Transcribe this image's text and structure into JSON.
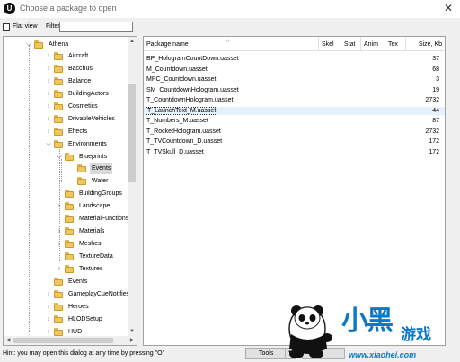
{
  "window": {
    "title": "Choose a package to open",
    "app_icon": "U",
    "close": "✕"
  },
  "filterbar": {
    "flat_view_label": "Flat view",
    "filter_label": "Filter:",
    "filter_value": ""
  },
  "tree": {
    "items": [
      {
        "label": "Athena",
        "expander": "⌵"
      },
      {
        "label": "Aircraft",
        "expander": "›"
      },
      {
        "label": "Bacchus",
        "expander": "›"
      },
      {
        "label": "Balance",
        "expander": "›"
      },
      {
        "label": "BuildingActors",
        "expander": "›"
      },
      {
        "label": "Cosmetics",
        "expander": "›"
      },
      {
        "label": "DrivableVehicles",
        "expander": "›"
      },
      {
        "label": "Effects",
        "expander": "›"
      },
      {
        "label": "Environments",
        "expander": "⌵"
      },
      {
        "label": "Blueprints",
        "expander": "⌵"
      },
      {
        "label": "Events",
        "expander": ""
      },
      {
        "label": "Water",
        "expander": ""
      },
      {
        "label": "BuildingGroups",
        "expander": ""
      },
      {
        "label": "Landscape",
        "expander": "›"
      },
      {
        "label": "MaterialFunctions",
        "expander": ""
      },
      {
        "label": "Materials",
        "expander": "›"
      },
      {
        "label": "Meshes",
        "expander": "›"
      },
      {
        "label": "TextureData",
        "expander": ""
      },
      {
        "label": "Textures",
        "expander": "›"
      },
      {
        "label": "Events",
        "expander": ""
      },
      {
        "label": "GameplayCueNotifies",
        "expander": "›"
      },
      {
        "label": "Heroes",
        "expander": "›"
      },
      {
        "label": "HLODSetup",
        "expander": "›"
      },
      {
        "label": "HUD",
        "expander": "›"
      }
    ]
  },
  "files": {
    "columns": [
      "Package name",
      "Skel",
      "Stat",
      "Anim",
      "Tex",
      "Size, Kb"
    ],
    "rows": [
      {
        "name": "BP_HologramCountDown.uasset",
        "size": "37"
      },
      {
        "name": "M_Countdown.uasset",
        "size": "68"
      },
      {
        "name": "MPC_Countdown.uasset",
        "size": "3"
      },
      {
        "name": "SM_CountdownHologram.uasset",
        "size": "19"
      },
      {
        "name": "T_CountdownHologram.uasset",
        "size": "2732"
      },
      {
        "name": "T_LaunchText_M.uasset",
        "size": "44"
      },
      {
        "name": "T_Numbers_M.uasset",
        "size": "87"
      },
      {
        "name": "T_RocketHologram.uasset",
        "size": "2732"
      },
      {
        "name": "T_TVCountdown_D.uasset",
        "size": "172"
      },
      {
        "name": "T_TVSkull_D.uasset",
        "size": "172"
      }
    ]
  },
  "status": {
    "hint": "Hint: you may open this dialog at any time by pressing \"O\"",
    "tools_label": "Tools",
    "tools_dropdown": "▼"
  },
  "watermark": {
    "logo_text": "小黑",
    "logo_sub": "游戏",
    "url": "www.xiaohei.com"
  },
  "icons": {
    "folder": "folder-icon",
    "panda": "panda-mascot"
  }
}
